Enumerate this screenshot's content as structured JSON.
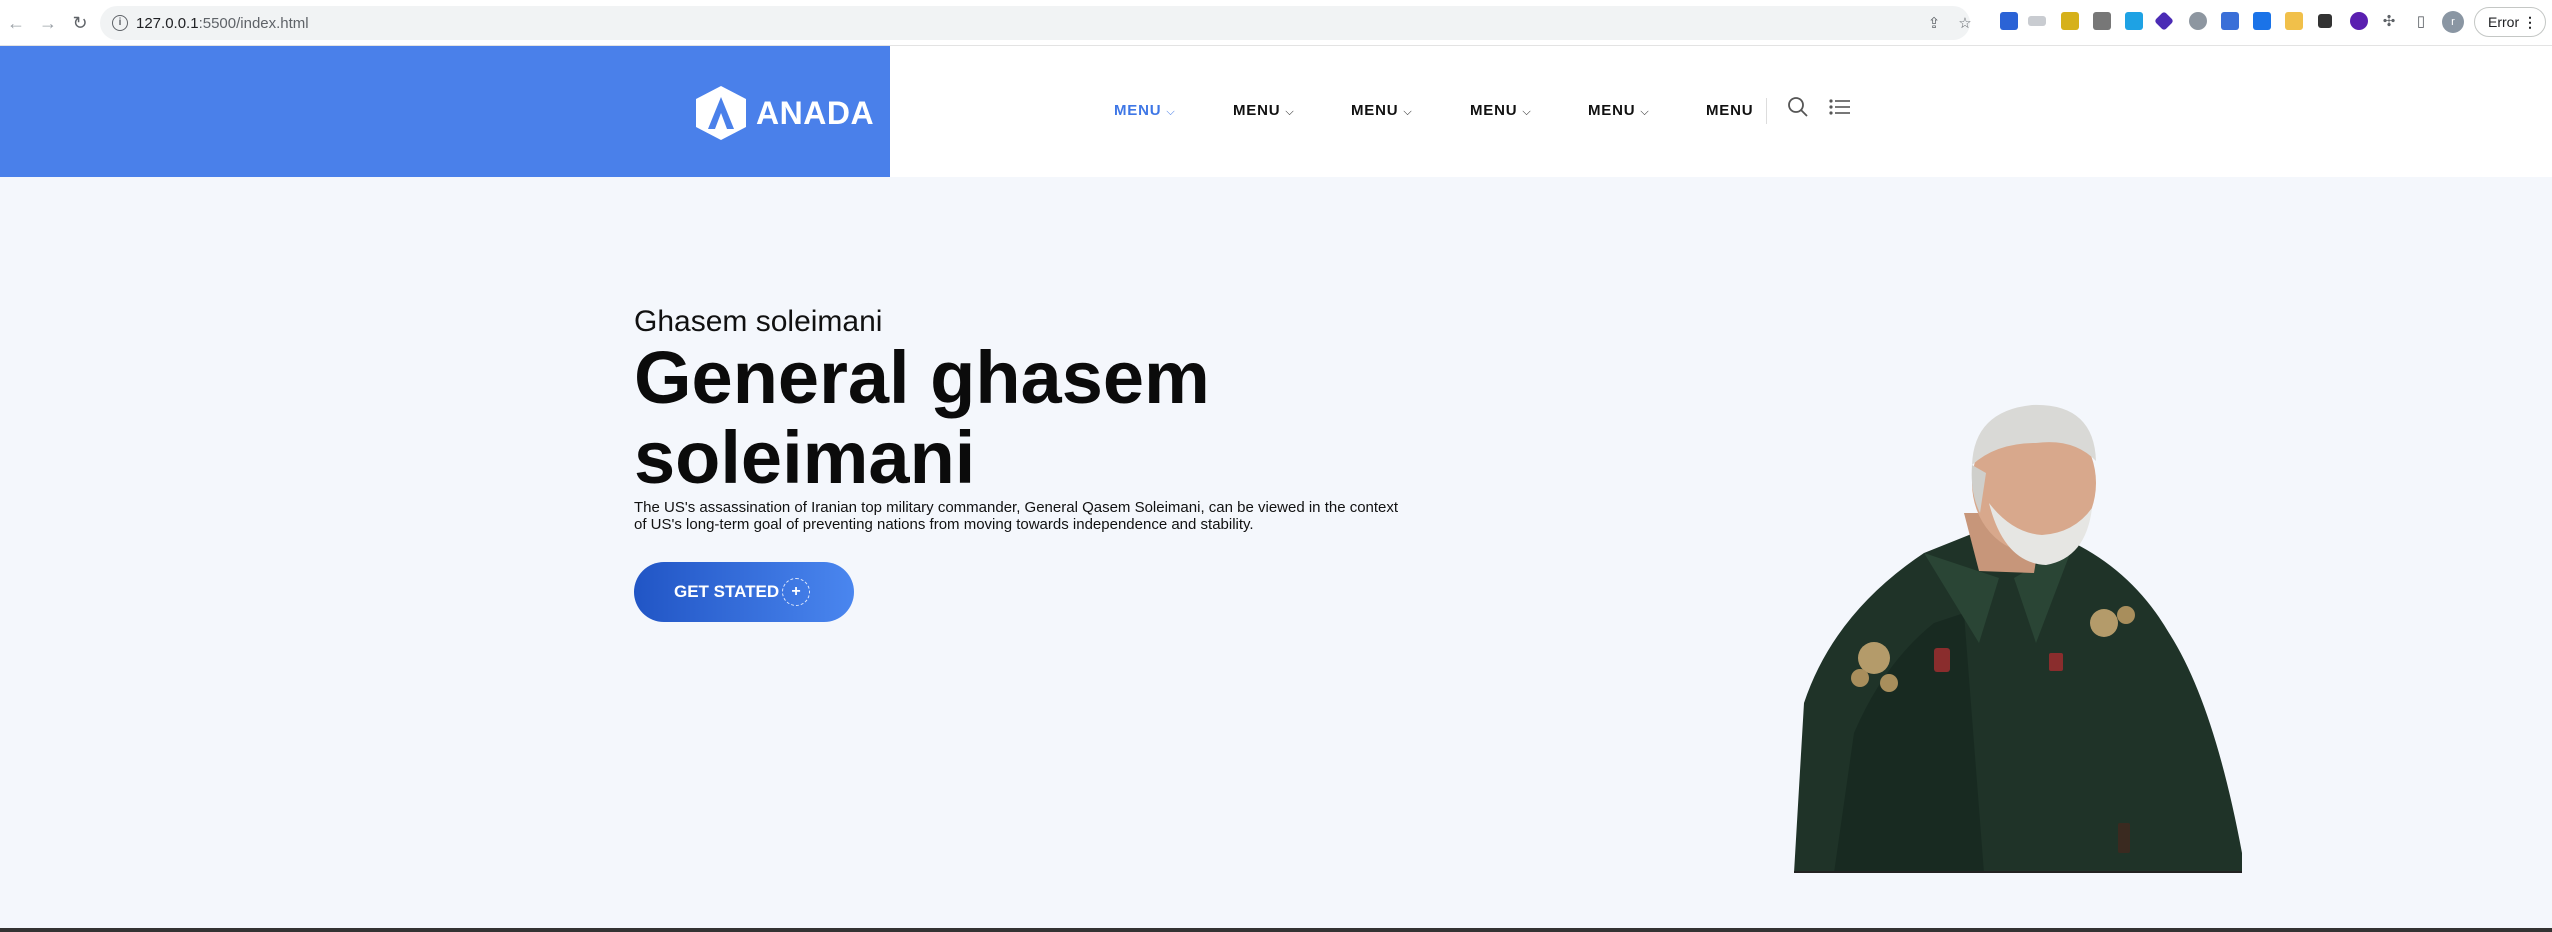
{
  "browser": {
    "url_host": "127.0.0.1",
    "url_path": ":5500/index.html",
    "profile_initial": "r",
    "error_label": "Error"
  },
  "header": {
    "logo_text": "ANADA",
    "menu": [
      {
        "label": "MENU",
        "has_dropdown": true,
        "active": true
      },
      {
        "label": "MENU",
        "has_dropdown": true,
        "active": false
      },
      {
        "label": "MENU",
        "has_dropdown": true,
        "active": false
      },
      {
        "label": "MENU",
        "has_dropdown": true,
        "active": false
      },
      {
        "label": "MENU",
        "has_dropdown": true,
        "active": false
      },
      {
        "label": "MENU",
        "has_dropdown": false,
        "active": false
      }
    ],
    "icons": [
      "search-icon",
      "list-icon"
    ]
  },
  "hero": {
    "subtitle": "Ghasem soleimani",
    "title": "General ghasem soleimani",
    "description": "The US's assassination of Iranian top military commander, General Qasem Soleimani, can be viewed in the context of US's long-term goal of preventing nations from moving towards independence and stability.",
    "cta_label": "GET STATED",
    "cta_icon": "+"
  },
  "colors": {
    "brand_blue": "#4a80ea",
    "active_menu": "#3f77e6",
    "hero_bg": "#f4f7fc"
  }
}
